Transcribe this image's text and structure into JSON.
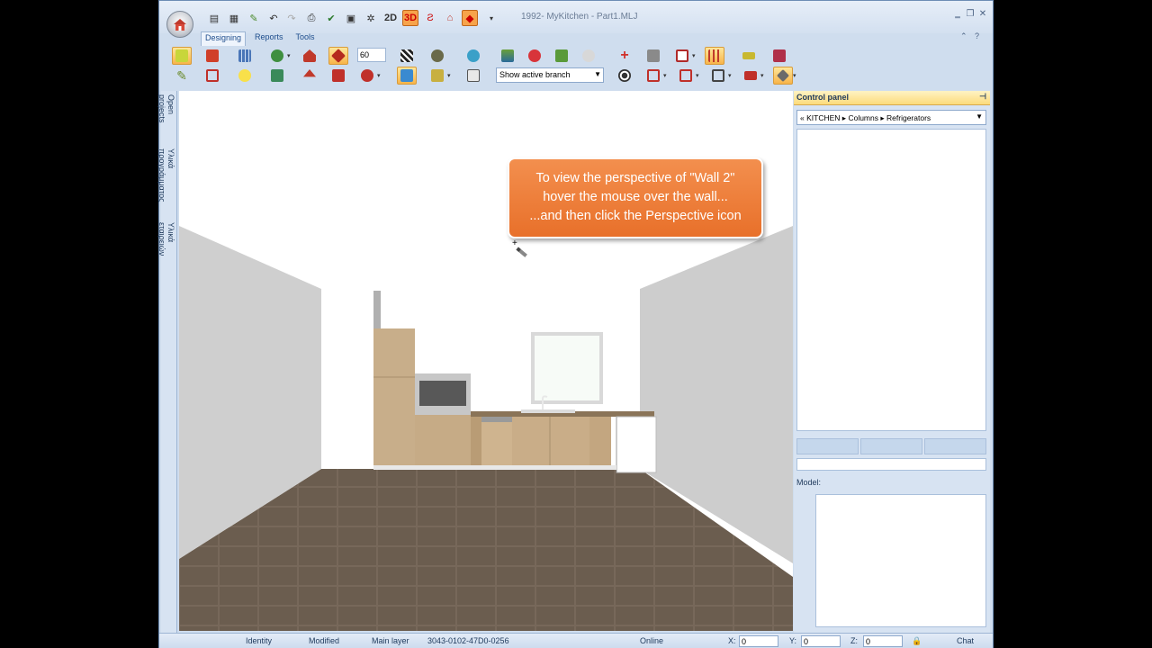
{
  "window": {
    "title": "1992- MyKitchen - Part1.MLJ"
  },
  "quick_access": {
    "label_2d": "2D",
    "label_3d": "3D"
  },
  "ribbon": {
    "tabs": [
      "Designing",
      "Reports",
      "Tools"
    ]
  },
  "toolbar": {
    "zoom_value": "60",
    "branch_select": "Show active branch"
  },
  "left_rail": [
    "Open projects",
    "Υλικά προγράμματος",
    "Υλικά εταιρειών"
  ],
  "tooltip": {
    "line1": "To view the perspective of \"Wall 2\"",
    "line2": "hover the mouse over the wall...",
    "line3": "...and then click the Perspective icon"
  },
  "control_panel": {
    "title": "Control panel",
    "breadcrumb": [
      "KITCHEN",
      "Columns",
      "Refrigerators"
    ],
    "model_label": "Model:"
  },
  "status_bar": {
    "identity": "Identity",
    "modified": "Modified",
    "layer": "Main layer",
    "code": "3043-0102-47D0-0256",
    "online": "Online",
    "x_label": "X:",
    "x_value": "0",
    "y_label": "Y:",
    "y_value": "0",
    "z_label": "Z:",
    "z_value": "0",
    "chat": "Chat"
  }
}
